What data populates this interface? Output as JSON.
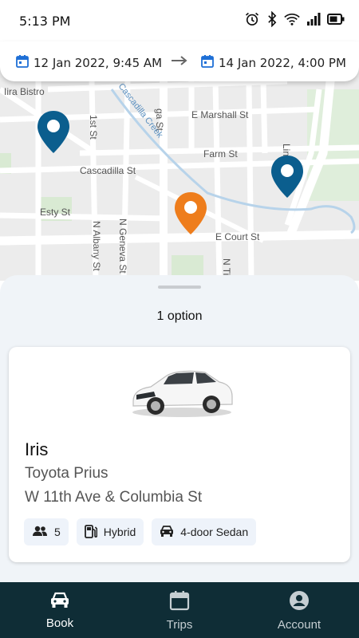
{
  "status_bar": {
    "time": "5:13 PM",
    "icons": [
      "alarm-icon",
      "bluetooth-icon",
      "wifi-icon",
      "signal-icon",
      "battery-icon"
    ]
  },
  "date_range": {
    "start": "12 Jan 2022, 9:45 AM",
    "end": "14 Jan 2022, 4:00 PM"
  },
  "map": {
    "street_labels": [
      "E Marshall St",
      "Farm St",
      "Cascadilla St",
      "Esty St",
      "E Court St",
      "1st St",
      "N Albany St",
      "N Geneva St",
      "N Tioga St",
      "Cascadilla Creek",
      "Iira Bistro",
      "ga St",
      "Lin St"
    ],
    "pins": [
      {
        "name": "station-pin",
        "color": "#0b5e8e"
      },
      {
        "name": "station-pin",
        "color": "#0b5e8e"
      },
      {
        "name": "user-location-pin",
        "color": "#ee7d1c"
      }
    ]
  },
  "results": {
    "count_label": "1 option"
  },
  "vehicle": {
    "name": "Iris",
    "model": "Toyota Prius",
    "location": "W 11th Ave & Columbia St",
    "seats": "5",
    "fuel": "Hybrid",
    "body": "4-door Sedan"
  },
  "nav": {
    "book": "Book",
    "trips": "Trips",
    "account": "Account"
  },
  "colors": {
    "nav_background": "#0f2d36",
    "accent_blue": "#1e6fd6",
    "pin_blue": "#0b5e8e",
    "pin_orange": "#ee7d1c"
  }
}
